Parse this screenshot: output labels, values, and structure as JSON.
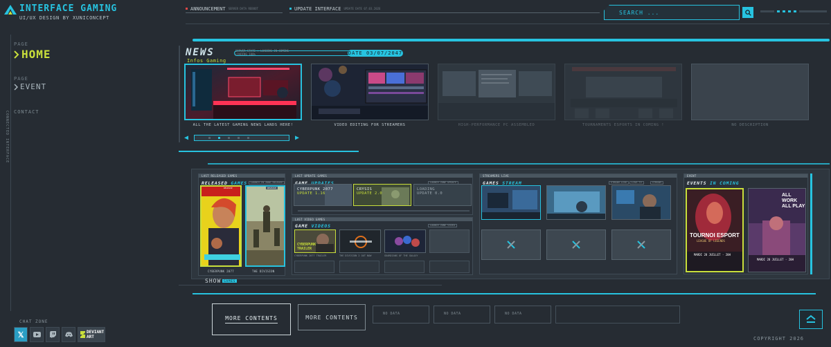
{
  "brand": {
    "title": "INTERFACE GAMING",
    "subtitle": "UI/UX DESIGN BY XUNICONCEPT"
  },
  "topbar": {
    "announcement_label": "ANNOUNCEMENT",
    "announcement_note": "SERVER DATA REBOOT",
    "update_label": "UPDATE INTERFACE",
    "update_note": "UPDATE DATE 07.03.2026",
    "search_placeholder": "SEARCH ..."
  },
  "sidebar": {
    "home_page_label": "PAGE",
    "home_label": "HOME",
    "event_page_label": "PAGE",
    "event_label": "EVENT",
    "contact_label": "CONTACT",
    "vertical_text": "CONNECTED INTERFACE",
    "chat_label": "CHAT ZONE",
    "socials": [
      "X",
      "YouTube",
      "Twitch",
      "Discord",
      "DeviantArt"
    ],
    "deviantart_line1": "DEVIANT",
    "deviantart_line2": "ART"
  },
  "news": {
    "title": "NEWS",
    "subtitle": "Infos Gaming",
    "status_line1": "SERVER STATE : LOADING IN COMING",
    "status_line2": "LOADING 100%",
    "date": "DATE 03/07/2047",
    "items": [
      {
        "caption": "ALL THE LATEST GAMING NEWS LANDS HERE!",
        "icon": "neon-desk-image"
      },
      {
        "caption": "VIDEO EDITING FOR STREAMERS",
        "icon": "editing-setup-image"
      },
      {
        "caption": "HIGH-PERFORMANCE PC ASSEMBLED",
        "icon": "pc-monitors-image"
      },
      {
        "caption": "TOURNAMENTS ESPORTS IN COMING !",
        "icon": "esport-arena-image"
      },
      {
        "caption": "NO DESCRIPTION",
        "icon": "empty"
      }
    ]
  },
  "released": {
    "top_label": "LAST RELEASED GAMES",
    "title_a": "RELEASED",
    "title_b": " GAMES",
    "link_label": "LAUNCH IN ZONE RELEASE",
    "posters": [
      {
        "caption": "CYBERPUNK 2077",
        "badge": "RELEASE"
      },
      {
        "caption": "THE DIVISION",
        "badge": "RELEASE"
      }
    ],
    "show_label": "SHOW",
    "show_tag": "GAMES"
  },
  "updates": {
    "top_label": "LAST UPDATE GAMES",
    "title_a": "GAME",
    "title_b": " UPDATES",
    "link_label": "LAUNCH ZONE UPDATE",
    "cards": [
      {
        "line1": "CYBERPUNK 2077",
        "line2": "UPDATE 1.16"
      },
      {
        "line1": "CRYSIS",
        "line2": "UPDATE 2.0"
      },
      {
        "line1": "LOADING",
        "line2": "UPDATE 0.0"
      }
    ]
  },
  "videos": {
    "top_label": "LAST VIDEO GAMES",
    "title_a": "GAME",
    "title_b": " VIDEOS",
    "link_label": "LAUNCH ZONE VIDEO",
    "thumbs": [
      {
        "caption": "CYBERPUNK 2077 TRAILER",
        "overlay_line1": "CYBERPUNK",
        "overlay_line2": "TRAILER"
      },
      {
        "caption": "THE DIVISION 2 OUT NOW"
      },
      {
        "caption": "GUARDIANS OF THE GALAXY"
      },
      {
        "caption": ""
      }
    ]
  },
  "streams": {
    "top_label": "STREAMERS LIVE",
    "title_a": "GAMES",
    "title_b": " STREAM",
    "link_labels": [
      "STREAM LIVE",
      "LIVE TV",
      "STREAM"
    ]
  },
  "events": {
    "top_label": "EVENT",
    "title_a": "EVENTS",
    "title_b": " IN COMING",
    "posters": [
      {
        "title": "TOURNOI ESPORT",
        "sub": "LEAGUE OF LEGENDS",
        "date": "MARDI 28 JUILLET - 20H"
      },
      {
        "title": "ALL WORK ALL PLAY",
        "sub": "",
        "date": "MARDI 28 JUILLET - 20H"
      }
    ]
  },
  "bottom": {
    "more_contents_1": "MORE CONTENTS",
    "more_contents_2": "MORE CONTENTS",
    "no_data": [
      "NO DATA",
      "NO DATA",
      "NO DATA"
    ],
    "copyright": "COPYRIGHT 2026"
  },
  "colors": {
    "accent": "#27c3e0",
    "highlight": "#c9df3b",
    "background": "#262c33"
  }
}
